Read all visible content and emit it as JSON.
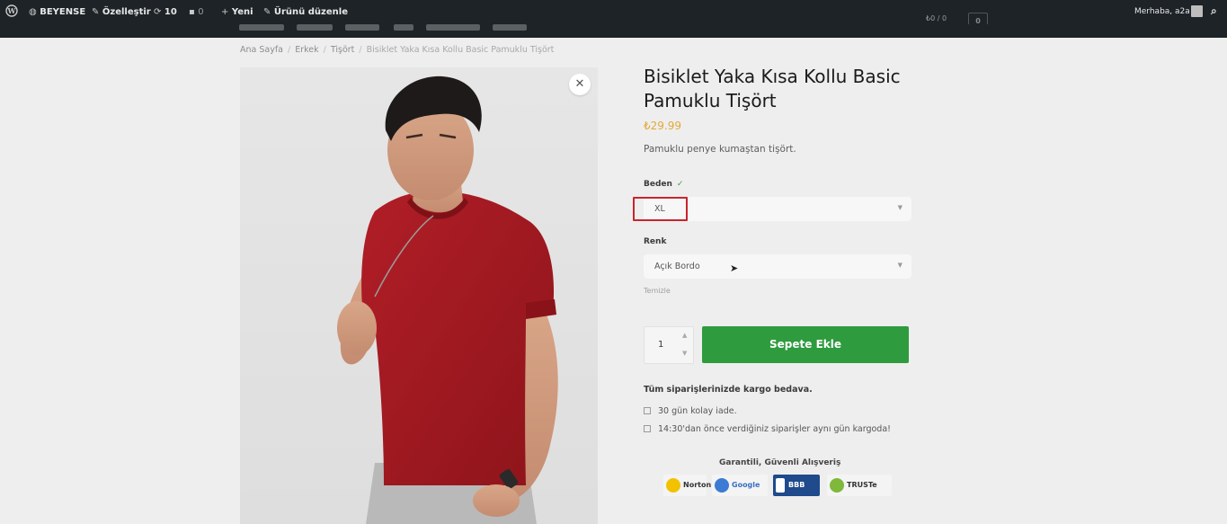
{
  "admin_bar": {
    "site_name": "BEYENSE",
    "customize": "Özelleştir",
    "updates_count": "10",
    "comments_count": "0",
    "new_label": "Yeni",
    "edit_product": "Ürünü düzenle",
    "greeting": "Merhaba, a2a"
  },
  "breadcrumb": {
    "items": [
      "Ana Sayfa",
      "Erkek",
      "Tişört"
    ],
    "current": "Bisiklet Yaka Kısa Kollu Basic Pamuklu Tişört"
  },
  "product": {
    "title": "Bisiklet Yaka Kısa Kollu Basic Pamuklu Tişört",
    "price": "₺29.99",
    "short_description": "Pamuklu penye kumaştan tişört."
  },
  "options": {
    "size_label": "Beden",
    "size_value": "XL",
    "color_label": "Renk",
    "color_value": "Açık Bordo",
    "clear_label": "Temizle"
  },
  "cart": {
    "quantity": "1",
    "add_to_cart": "Sepete Ekle"
  },
  "shipping": {
    "title": "Tüm siparişlerinizde kargo bedava.",
    "lines": [
      "30 gün kolay iade.",
      "14:30'dan önce verdiğiniz siparişler aynı gün kargoda!"
    ]
  },
  "trust": {
    "title": "Garantili, Güvenli Alışveriş",
    "badges": [
      "Norton",
      "Google",
      "BBB",
      "TRUSTe"
    ]
  },
  "colors": {
    "accent_green": "#2e9b3e",
    "price_orange": "#e3a93a",
    "shirt_red": "#a41a22",
    "highlight_red": "#c8252e"
  }
}
